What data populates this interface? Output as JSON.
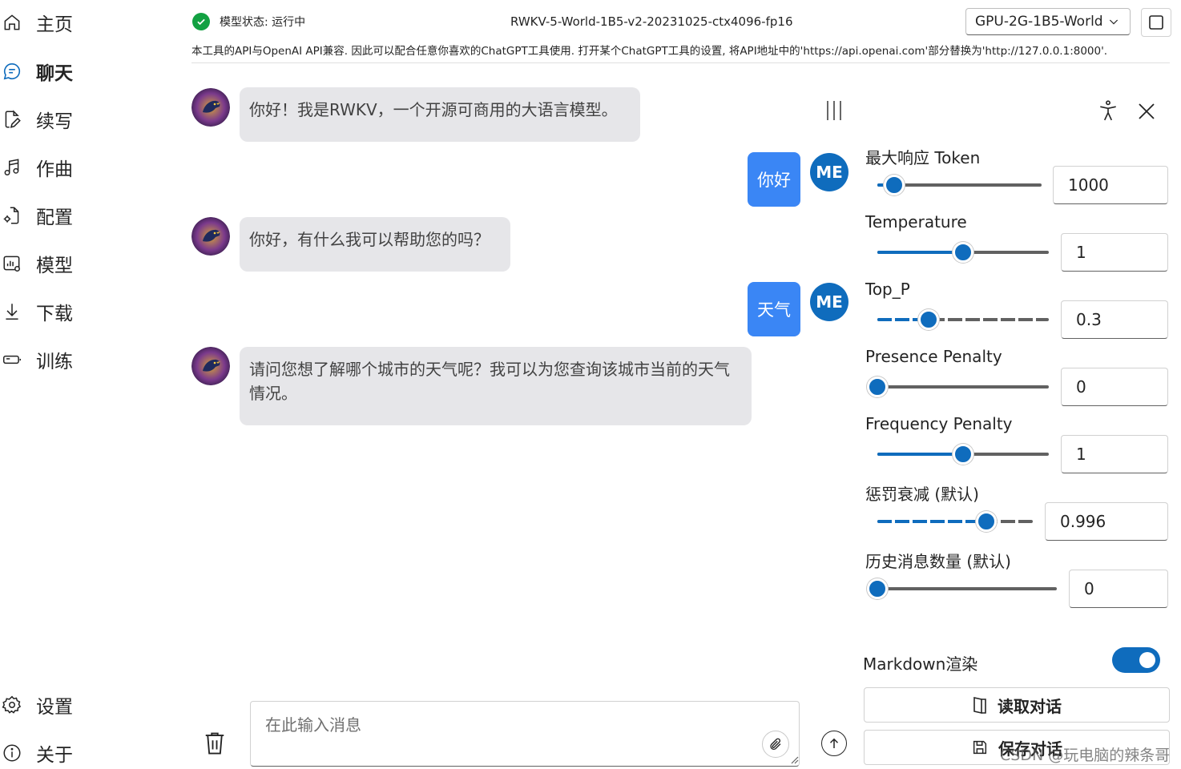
{
  "sidebar": {
    "items": [
      {
        "label": "主页",
        "icon": "home-icon"
      },
      {
        "label": "聊天",
        "icon": "chat-icon",
        "active": true
      },
      {
        "label": "续写",
        "icon": "document-edit-icon"
      },
      {
        "label": "作曲",
        "icon": "music-note-icon"
      },
      {
        "label": "配置",
        "icon": "document-settings-icon"
      },
      {
        "label": "模型",
        "icon": "data-settings-icon"
      },
      {
        "label": "下载",
        "icon": "download-icon"
      },
      {
        "label": "训练",
        "icon": "battery-icon"
      }
    ],
    "bottom_items": [
      {
        "label": "设置",
        "icon": "settings-icon"
      },
      {
        "label": "关于",
        "icon": "info-icon"
      }
    ]
  },
  "header": {
    "status_text": "模型状态: 运行中",
    "model_name": "RWKV-5-World-1B5-v2-20231025-ctx4096-fp16",
    "model_select_value": "GPU-2G-1B5-World",
    "notice": "本工具的API与OpenAI API兼容. 因此可以配合任意你喜欢的ChatGPT工具使用. 打开某个ChatGPT工具的设置, 将API地址中的'https://api.openai.com'部分替换为'http://127.0.0.1:8000'."
  },
  "chat": {
    "me_label": "ME",
    "messages": [
      {
        "role": "bot",
        "text": "你好！我是RWKV，一个开源可商用的大语言模型。"
      },
      {
        "role": "user",
        "text": "你好"
      },
      {
        "role": "bot",
        "text": "你好，有什么我可以帮助您的吗？"
      },
      {
        "role": "user",
        "text": "天气"
      },
      {
        "role": "bot",
        "text": "请问您想了解哪个城市的天气呢？我可以为您查询该城市当前的天气情况。"
      }
    ],
    "input_placeholder": "在此输入消息"
  },
  "params": {
    "max_tokens": {
      "label": "最大响应 Token",
      "value": "1000",
      "fraction": 0.1
    },
    "temperature": {
      "label": "Temperature",
      "value": "1",
      "fraction": 0.5
    },
    "top_p": {
      "label": "Top_P",
      "value": "0.3",
      "fraction": 0.3
    },
    "presence_penalty": {
      "label": "Presence Penalty",
      "value": "0",
      "fraction": 0.0
    },
    "frequency_penalty": {
      "label": "Frequency Penalty",
      "value": "1",
      "fraction": 0.5
    },
    "penalty_decay": {
      "label": "惩罚衰减 (默认)",
      "value": "0.996",
      "fraction": 0.7
    },
    "history_count": {
      "label": "历史消息数量 (默认)",
      "value": "0",
      "fraction": 0.0
    }
  },
  "markdown_toggle": {
    "label": "Markdown渲染",
    "on": true
  },
  "buttons": {
    "read_conversation": "读取对话",
    "save_conversation": "保存对话"
  },
  "watermark": "CSDN @玩电脑的辣条哥"
}
